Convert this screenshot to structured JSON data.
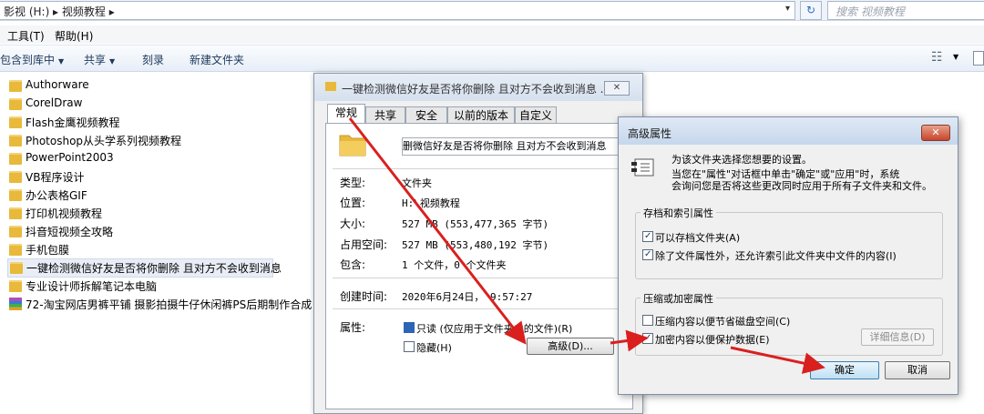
{
  "address": {
    "path": "影视 (H:)  ▸  视频教程  ▸",
    "search_placeholder": "搜索 视频教程"
  },
  "menu": {
    "tools": "工具(T)",
    "help": "帮助(H)"
  },
  "toolbar": {
    "include_library": "包含到库中",
    "share": "共享",
    "burn": "刻录",
    "new_folder": "新建文件夹"
  },
  "files": [
    "Authorware",
    "CorelDraw",
    "Flash金鹰视频教程",
    "Photoshop从头学系列视频教程",
    "PowerPoint2003",
    "VB程序设计",
    "办公表格GIF",
    "打印机视频教程",
    "抖音短视频全攻略",
    "手机包膜",
    "一键检测微信好友是否将你删除 且对方不会收到消息",
    "专业设计师拆解笔记本电脑",
    "72-淘宝网店男裤平铺 摄影拍摄牛仔休闲裤PS后期制作合成 视频"
  ],
  "properties": {
    "title": "一键检测微信好友是否将你删除 且对方不会收到消息 ...",
    "close": "✕",
    "tabs": [
      "常规",
      "共享",
      "安全",
      "以前的版本",
      "自定义"
    ],
    "name_value": "删微信好友是否将你删除 且对方不会收到消息",
    "type_label": "类型:",
    "type_value": "文件夹",
    "location_label": "位置:",
    "location_value": "H:\\视频教程",
    "size_label": "大小:",
    "size_value": "527 MB (553,477,365 字节)",
    "disk_label": "占用空间:",
    "disk_value": "527 MB (553,480,192 字节)",
    "contains_label": "包含:",
    "contains_value": "1 个文件，0 个文件夹",
    "created_label": "创建时间:",
    "created_value": "2020年6月24日， 9:57:27",
    "attributes_label": "属性:",
    "readonly_label": "只读 (仅应用于文件夹中的文件)(R)",
    "hidden_label": "隐藏(H)",
    "advanced_button": "高级(D)..."
  },
  "advanced": {
    "title": "高级属性",
    "close": "✕",
    "desc1": "为该文件夹选择您想要的设置。",
    "desc2": "当您在\"属性\"对话框中单击\"确定\"或\"应用\"时，系统",
    "desc3": "会询问您是否将这些更改同时应用于所有子文件夹和文件。",
    "group1_title": "存档和索引属性",
    "archive_label": "可以存档文件夹(A)",
    "index_label": "除了文件属性外，还允许索引此文件夹中文件的内容(I)",
    "group2_title": "压缩或加密属性",
    "compress_label": "压缩内容以便节省磁盘空间(C)",
    "encrypt_label": "加密内容以便保护数据(E)",
    "details_button": "详细信息(D)",
    "ok_button": "确定",
    "cancel_button": "取消"
  },
  "colors": {
    "arrow": "#d9201f",
    "folder": "#e8b93a",
    "selection": "#e9eef6"
  }
}
